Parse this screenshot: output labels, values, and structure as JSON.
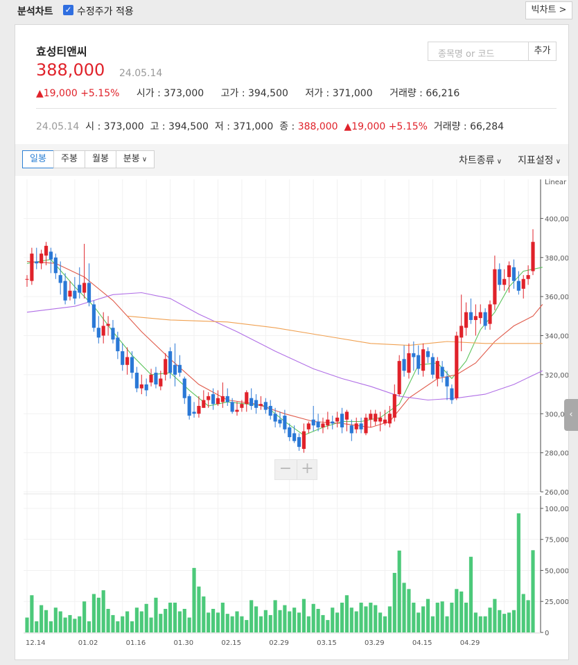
{
  "header": {
    "title": "분석차트",
    "adjusted_label": "수정주가 적용",
    "adjusted_checked": true,
    "big_chart_label": "빅차트 >"
  },
  "stock": {
    "name": "효성티앤씨",
    "price": "388,000",
    "date": "24.05.14",
    "change": "▲19,000 +5.15%",
    "open": "시가 : 373,000",
    "high": "고가 : 394,500",
    "low": "저가 : 371,000",
    "volume": "거래량 : 66,216"
  },
  "search": {
    "placeholder": "종목명 or 코드",
    "add_label": "추가"
  },
  "summary": {
    "date": "24.05.14",
    "open": "시 : 373,000",
    "high": "고 : 394,500",
    "low": "저 : 371,000",
    "close_label": "종 : ",
    "close": "388,000",
    "change": "▲19,000 +5.15%",
    "volume": "거래량 : 66,284"
  },
  "toolbar": {
    "periods": [
      "일봉",
      "주봉",
      "월봉",
      "분봉"
    ],
    "active_period": "일봉",
    "chart_type_label": "차트종류",
    "indicator_label": "지표설정"
  },
  "colors": {
    "up": "#e0222a",
    "down": "#2a78d6",
    "volume": "#4cc97a",
    "ma5": "#5cc45c",
    "ma20": "#e05a4a",
    "ma60": "#b06ee6",
    "ma120": "#f0a050"
  },
  "chart_data": {
    "type": "candlestick",
    "scale_label": "Linear",
    "price_axis": {
      "min": 260000,
      "max": 420000,
      "ticks": [
        "400,000",
        "380,000",
        "360,000",
        "340,000",
        "320,000",
        "300,000",
        "280,000",
        "260,000"
      ]
    },
    "volume_axis": {
      "min": 0,
      "max": 110000,
      "ticks": [
        "100,000",
        "75,000",
        "50,000",
        "25,000",
        "0"
      ]
    },
    "x_labels": [
      {
        "label": "12.14",
        "index": 0
      },
      {
        "label": "01.02",
        "index": 11
      },
      {
        "label": "01.16",
        "index": 21
      },
      {
        "label": "01.30",
        "index": 31
      },
      {
        "label": "02.15",
        "index": 41
      },
      {
        "label": "02.29",
        "index": 51
      },
      {
        "label": "03.15",
        "index": 61
      },
      {
        "label": "03.29",
        "index": 71
      },
      {
        "label": "04.15",
        "index": 81
      },
      {
        "label": "04.29",
        "index": 91
      }
    ],
    "candles": [
      [
        369000,
        369000,
        371000,
        365000,
        12000
      ],
      [
        368000,
        382000,
        385000,
        366000,
        30000
      ],
      [
        378000,
        377000,
        385000,
        374000,
        9000
      ],
      [
        377000,
        382000,
        384000,
        374000,
        22000
      ],
      [
        381000,
        386000,
        388000,
        376000,
        18000
      ],
      [
        383000,
        379000,
        385000,
        372000,
        9000
      ],
      [
        380000,
        372000,
        382000,
        369000,
        20000
      ],
      [
        371000,
        367000,
        378000,
        361000,
        17000
      ],
      [
        368000,
        358000,
        372000,
        356000,
        12000
      ],
      [
        360000,
        363000,
        368000,
        358000,
        14000
      ],
      [
        363000,
        359000,
        370000,
        356000,
        11000
      ],
      [
        366000,
        362000,
        375000,
        359000,
        13000
      ],
      [
        362000,
        367000,
        387000,
        359000,
        25000
      ],
      [
        367000,
        357000,
        377000,
        355000,
        9000
      ],
      [
        356000,
        344000,
        358000,
        342000,
        31000
      ],
      [
        344000,
        339000,
        350000,
        336000,
        28000
      ],
      [
        340000,
        345000,
        352000,
        336000,
        34000
      ],
      [
        345000,
        346000,
        350000,
        340000,
        19000
      ],
      [
        344000,
        338000,
        348000,
        336000,
        14000
      ],
      [
        339000,
        332000,
        342000,
        328000,
        9000
      ],
      [
        332000,
        325000,
        336000,
        322000,
        13000
      ],
      [
        325000,
        329000,
        334000,
        320000,
        17000
      ],
      [
        329000,
        321000,
        332000,
        318000,
        9000
      ],
      [
        321000,
        313000,
        324000,
        311000,
        20000
      ],
      [
        313000,
        315000,
        320000,
        310000,
        17000
      ],
      [
        315000,
        312000,
        318000,
        309000,
        23000
      ],
      [
        316000,
        320000,
        323000,
        314000,
        12000
      ],
      [
        321000,
        315000,
        324000,
        313000,
        28000
      ],
      [
        314000,
        318000,
        322000,
        312000,
        15000
      ],
      [
        320000,
        328000,
        331000,
        317000,
        19000
      ],
      [
        332000,
        321000,
        334000,
        318000,
        24000
      ],
      [
        325000,
        320000,
        336000,
        314000,
        24000
      ],
      [
        325000,
        321000,
        330000,
        319000,
        17000
      ],
      [
        318000,
        308000,
        319000,
        305000,
        19000
      ],
      [
        309000,
        299000,
        310000,
        297000,
        12000
      ],
      [
        301000,
        300000,
        306000,
        298000,
        52000
      ],
      [
        300000,
        304000,
        309000,
        298000,
        37000
      ],
      [
        303000,
        307000,
        312000,
        303000,
        29000
      ],
      [
        307000,
        309000,
        311000,
        303000,
        16000
      ],
      [
        310000,
        305000,
        313000,
        302000,
        19000
      ],
      [
        305000,
        308000,
        312000,
        304000,
        16000
      ],
      [
        306000,
        309000,
        316000,
        303000,
        24000
      ],
      [
        309000,
        306000,
        313000,
        304000,
        15000
      ],
      [
        306000,
        301000,
        308000,
        300000,
        13000
      ],
      [
        301000,
        302000,
        306000,
        299000,
        17000
      ],
      [
        303000,
        305000,
        307000,
        301000,
        13000
      ],
      [
        305000,
        311000,
        312000,
        301000,
        10000
      ],
      [
        308000,
        304000,
        313000,
        302000,
        26000
      ],
      [
        307000,
        303000,
        310000,
        300000,
        21000
      ],
      [
        304000,
        305000,
        309000,
        302000,
        13000
      ],
      [
        306000,
        302000,
        308000,
        300000,
        18000
      ],
      [
        304000,
        299000,
        307000,
        297000,
        14000
      ],
      [
        300000,
        296000,
        303000,
        293000,
        26000
      ],
      [
        297000,
        295000,
        301000,
        293000,
        18000
      ],
      [
        299000,
        292000,
        302000,
        290000,
        22000
      ],
      [
        293000,
        288000,
        295000,
        286000,
        17000
      ],
      [
        290000,
        286000,
        294000,
        285000,
        20000
      ],
      [
        288000,
        283000,
        290000,
        281000,
        16000
      ],
      [
        282000,
        291000,
        295000,
        280000,
        27000
      ],
      [
        292000,
        295000,
        296000,
        290000,
        13000
      ],
      [
        297000,
        294000,
        304000,
        291000,
        23000
      ],
      [
        296000,
        293000,
        300000,
        291000,
        19000
      ],
      [
        293000,
        295000,
        298000,
        290000,
        14000
      ],
      [
        294000,
        297000,
        301000,
        292000,
        10000
      ],
      [
        296000,
        295000,
        299000,
        292000,
        20000
      ],
      [
        296000,
        298000,
        301000,
        293000,
        16000
      ],
      [
        300000,
        293000,
        303000,
        290000,
        24000
      ],
      [
        297000,
        301000,
        302000,
        291000,
        30000
      ],
      [
        294000,
        290000,
        297000,
        286000,
        20000
      ],
      [
        292000,
        295000,
        298000,
        290000,
        17000
      ],
      [
        295000,
        292000,
        298000,
        290000,
        24000
      ],
      [
        290000,
        298000,
        300000,
        289000,
        21000
      ],
      [
        297000,
        300000,
        302000,
        293000,
        24000
      ],
      [
        296000,
        300000,
        302000,
        294000,
        22000
      ],
      [
        296000,
        298000,
        301000,
        291000,
        16000
      ],
      [
        295000,
        297000,
        302000,
        294000,
        13000
      ],
      [
        295000,
        300000,
        304000,
        293000,
        21000
      ],
      [
        298000,
        310000,
        315000,
        296000,
        48000
      ],
      [
        310000,
        327000,
        330000,
        309000,
        66000
      ],
      [
        328000,
        322000,
        335000,
        319000,
        40000
      ],
      [
        321000,
        331000,
        336000,
        318000,
        35000
      ],
      [
        331000,
        329000,
        337000,
        322000,
        24000
      ],
      [
        330000,
        323000,
        335000,
        320000,
        16000
      ],
      [
        322000,
        333000,
        336000,
        319000,
        21000
      ],
      [
        332000,
        329000,
        334000,
        326000,
        27000
      ],
      [
        329000,
        320000,
        331000,
        318000,
        13000
      ],
      [
        318000,
        327000,
        329000,
        314000,
        24000
      ],
      [
        324000,
        319000,
        327000,
        316000,
        25000
      ],
      [
        319000,
        314000,
        322000,
        307000,
        13000
      ],
      [
        313000,
        307000,
        315000,
        305000,
        24000
      ],
      [
        308000,
        340000,
        342000,
        307000,
        35000
      ],
      [
        339000,
        345000,
        361000,
        332000,
        33000
      ],
      [
        344000,
        352000,
        357000,
        340000,
        24000
      ],
      [
        352000,
        348000,
        359000,
        346000,
        61000
      ],
      [
        348000,
        350000,
        356000,
        340000,
        16000
      ],
      [
        349000,
        352000,
        356000,
        346000,
        13000
      ],
      [
        352000,
        345000,
        354000,
        343000,
        13000
      ],
      [
        346000,
        356000,
        358000,
        343000,
        20000
      ],
      [
        356000,
        374000,
        381000,
        353000,
        27000
      ],
      [
        374000,
        366000,
        377000,
        363000,
        18000
      ],
      [
        366000,
        369000,
        374000,
        363000,
        15000
      ],
      [
        370000,
        376000,
        378000,
        362000,
        16000
      ],
      [
        375000,
        368000,
        379000,
        364000,
        18000
      ],
      [
        368000,
        363000,
        373000,
        361000,
        96000
      ],
      [
        364000,
        369000,
        371000,
        359000,
        31000
      ],
      [
        369000,
        371000,
        376000,
        366000,
        26000
      ],
      [
        373000,
        388000,
        394500,
        371000,
        66284
      ]
    ],
    "series": [
      {
        "name": "MA5",
        "color": "#5cc45c",
        "points": [
          [
            0,
            377000
          ],
          [
            5,
            379000
          ],
          [
            10,
            365000
          ],
          [
            14,
            355000
          ],
          [
            18,
            342000
          ],
          [
            22,
            330000
          ],
          [
            26,
            320000
          ],
          [
            30,
            321000
          ],
          [
            34,
            312000
          ],
          [
            38,
            304000
          ],
          [
            42,
            306000
          ],
          [
            46,
            305000
          ],
          [
            50,
            304000
          ],
          [
            54,
            296000
          ],
          [
            58,
            289000
          ],
          [
            62,
            293000
          ],
          [
            66,
            296000
          ],
          [
            70,
            296000
          ],
          [
            74,
            298000
          ],
          [
            78,
            305000
          ],
          [
            82,
            325000
          ],
          [
            86,
            326000
          ],
          [
            89,
            318000
          ],
          [
            92,
            327000
          ],
          [
            95,
            343000
          ],
          [
            98,
            352000
          ],
          [
            101,
            365000
          ],
          [
            104,
            373000
          ],
          [
            108,
            375000
          ]
        ]
      },
      {
        "name": "MA20",
        "color": "#e05a4a",
        "points": [
          [
            0,
            378000
          ],
          [
            6,
            377000
          ],
          [
            12,
            370000
          ],
          [
            18,
            358000
          ],
          [
            24,
            342000
          ],
          [
            30,
            328000
          ],
          [
            36,
            315000
          ],
          [
            42,
            307000
          ],
          [
            48,
            305000
          ],
          [
            54,
            300000
          ],
          [
            60,
            296000
          ],
          [
            66,
            295000
          ],
          [
            72,
            293000
          ],
          [
            76,
            296000
          ],
          [
            80,
            308000
          ],
          [
            86,
            318000
          ],
          [
            90,
            320000
          ],
          [
            94,
            326000
          ],
          [
            98,
            337000
          ],
          [
            102,
            345000
          ],
          [
            106,
            350000
          ],
          [
            108,
            356000
          ]
        ]
      },
      {
        "name": "MA60",
        "color": "#b06ee6",
        "points": [
          [
            0,
            352000
          ],
          [
            10,
            355000
          ],
          [
            18,
            361000
          ],
          [
            24,
            362000
          ],
          [
            30,
            359000
          ],
          [
            36,
            351000
          ],
          [
            44,
            342000
          ],
          [
            52,
            332000
          ],
          [
            60,
            323000
          ],
          [
            66,
            318000
          ],
          [
            72,
            314000
          ],
          [
            78,
            309000
          ],
          [
            84,
            307000
          ],
          [
            90,
            308000
          ],
          [
            96,
            310000
          ],
          [
            102,
            315000
          ],
          [
            108,
            322000
          ]
        ]
      },
      {
        "name": "MA120",
        "color": "#f0a050",
        "points": [
          [
            21,
            350000
          ],
          [
            30,
            348000
          ],
          [
            42,
            347000
          ],
          [
            52,
            344000
          ],
          [
            62,
            340000
          ],
          [
            72,
            336000
          ],
          [
            80,
            335000
          ],
          [
            88,
            337000
          ],
          [
            96,
            336000
          ],
          [
            104,
            336000
          ],
          [
            108,
            336000
          ]
        ]
      }
    ]
  }
}
